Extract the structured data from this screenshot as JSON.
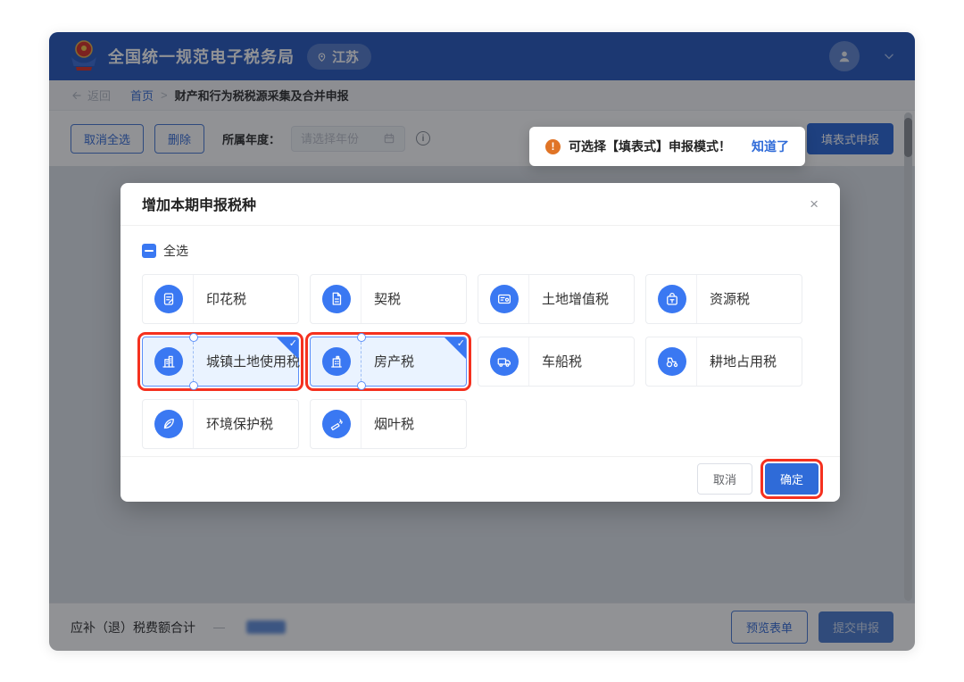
{
  "header": {
    "title": "全国统一规范电子税务局",
    "location": "江苏"
  },
  "breadcrumb": {
    "back_label": "返回",
    "home": "首页",
    "separator": ">",
    "current": "财产和行为税税源采集及合并申报"
  },
  "toolbar": {
    "cancel_select_all": "取消全选",
    "delete_label": "删除",
    "year_label": "所属年度：",
    "year_placeholder": "请选择年份",
    "form_mode_button": "填表式申报",
    "notice": {
      "icon": "!",
      "text": "可选择【填表式】申报模式！",
      "action": "知道了"
    }
  },
  "modal": {
    "title": "增加本期申报税种",
    "close": "×",
    "select_all": "全选",
    "taxes": [
      {
        "label": "印花税",
        "icon": "stamp-document-icon",
        "selected": false,
        "highlighted": false
      },
      {
        "label": "契税",
        "icon": "deed-document-icon",
        "selected": false,
        "highlighted": false
      },
      {
        "label": "土地增值税",
        "icon": "land-card-icon",
        "selected": false,
        "highlighted": false
      },
      {
        "label": "资源税",
        "icon": "resource-box-icon",
        "selected": false,
        "highlighted": false
      },
      {
        "label": "城镇土地使用税",
        "icon": "city-building-icon",
        "selected": true,
        "highlighted": true
      },
      {
        "label": "房产税",
        "icon": "house-building-icon",
        "selected": true,
        "highlighted": true
      },
      {
        "label": "车船税",
        "icon": "vehicle-icon",
        "selected": false,
        "highlighted": false
      },
      {
        "label": "耕地占用税",
        "icon": "tractor-icon",
        "selected": false,
        "highlighted": false
      },
      {
        "label": "环境保护税",
        "icon": "leaf-icon",
        "selected": false,
        "highlighted": false
      },
      {
        "label": "烟叶税",
        "icon": "tobacco-icon",
        "selected": false,
        "highlighted": false
      }
    ],
    "cancel": "取消",
    "confirm": "确定"
  },
  "footer": {
    "total_label": "应补（退）税费额合计",
    "preview_button": "预览表单",
    "submit_button": "提交申报"
  },
  "colors": {
    "header_blue": "#2a5cbf",
    "accent_blue": "#2f6bd8",
    "icon_blue": "#3a78f2",
    "selected_bg": "#eaf3ff",
    "highlight_red": "#f5311f",
    "notice_orange": "#e07426"
  }
}
